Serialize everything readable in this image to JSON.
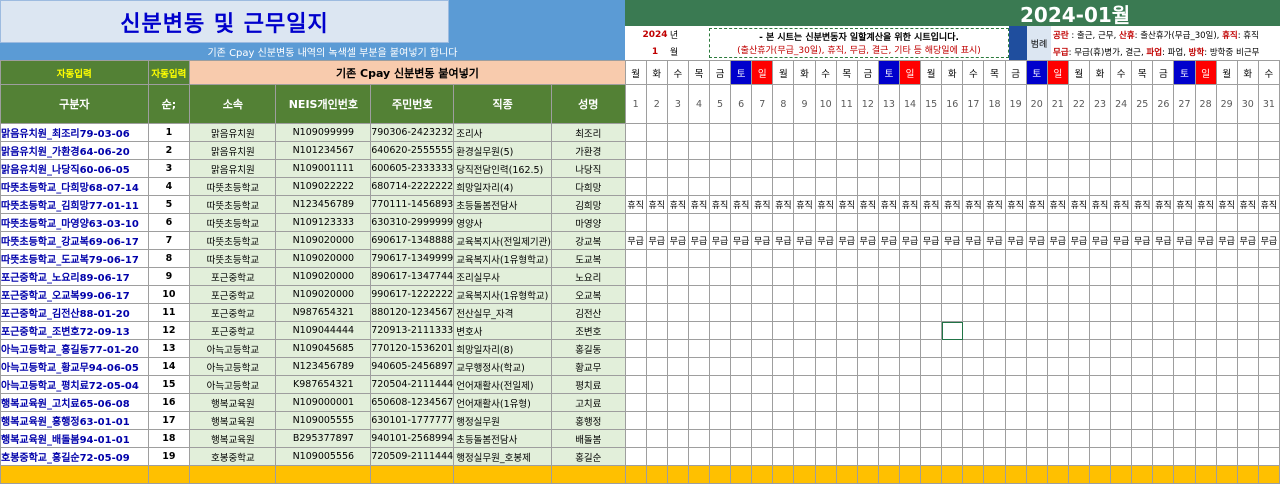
{
  "header": {
    "title": "신분변동 및 근무일지",
    "notice": "기존 Cpay 신분변동 내역의 녹색셀 부분을 붙여넣기 합니다",
    "month_title": "2024-01월",
    "year": "2024",
    "year_unit": "년",
    "month": "1",
    "month_unit": "월",
    "note_line1": "- 본 시트는 신분변동자 일할계산을 위한 시트입니다.",
    "note_line2": "(출산휴가(무급_30일), 휴직, 무급, 결근, 기타 등 해당일에 표시)",
    "legend_label": "범례",
    "legend_line1_red": "공란",
    "legend_line1_text": " : 출근, 근무, ",
    "legend_line1_red2": "산휴",
    "legend_line1_text2": ": 출산휴가(무급_30일),   ",
    "legend_line1_red3": "휴직",
    "legend_line1_text3": ": 휴직",
    "legend_line2_red": "무급",
    "legend_line2_text": ": 무급(휴)병가, 결근, ",
    "legend_line2_red2": "파업",
    "legend_line2_text2": ": 파업, ",
    "legend_line2_red3": "방학",
    "legend_line2_text3": ": 방학중 비근무"
  },
  "table_header": {
    "auto_input_1": "자동입력",
    "auto_input_2": "자동입력",
    "paste_title": "기존 Cpay 신분변동 붙여넣기",
    "columns": [
      "구분자",
      "순;",
      "소속",
      "NEIS개인번호",
      "주민번호",
      "직종",
      "성명"
    ]
  },
  "days": [
    {
      "dow": "월",
      "num": "1"
    },
    {
      "dow": "화",
      "num": "2"
    },
    {
      "dow": "수",
      "num": "3"
    },
    {
      "dow": "목",
      "num": "4"
    },
    {
      "dow": "금",
      "num": "5"
    },
    {
      "dow": "토",
      "num": "6"
    },
    {
      "dow": "일",
      "num": "7"
    },
    {
      "dow": "월",
      "num": "8"
    },
    {
      "dow": "화",
      "num": "9"
    },
    {
      "dow": "수",
      "num": "10"
    },
    {
      "dow": "목",
      "num": "11"
    },
    {
      "dow": "금",
      "num": "12"
    },
    {
      "dow": "토",
      "num": "13"
    },
    {
      "dow": "일",
      "num": "14"
    },
    {
      "dow": "월",
      "num": "15"
    },
    {
      "dow": "화",
      "num": "16"
    },
    {
      "dow": "수",
      "num": "17"
    },
    {
      "dow": "목",
      "num": "18"
    },
    {
      "dow": "금",
      "num": "19"
    },
    {
      "dow": "토",
      "num": "20"
    },
    {
      "dow": "일",
      "num": "21"
    },
    {
      "dow": "월",
      "num": "22"
    },
    {
      "dow": "화",
      "num": "23"
    },
    {
      "dow": "수",
      "num": "24"
    },
    {
      "dow": "목",
      "num": "25"
    },
    {
      "dow": "금",
      "num": "26"
    },
    {
      "dow": "토",
      "num": "27"
    },
    {
      "dow": "일",
      "num": "28"
    },
    {
      "dow": "월",
      "num": "29"
    },
    {
      "dow": "화",
      "num": "30"
    },
    {
      "dow": "수",
      "num": "31"
    }
  ],
  "rows": [
    {
      "key": "맑음유치원_최조리79-03-06",
      "no": "1",
      "org": "맑음유치원",
      "neis": "N109099999",
      "rrn": "790306-2423232",
      "job": "조리사",
      "name": "최조리",
      "status": ""
    },
    {
      "key": "맑음유치원_가환경64-06-20",
      "no": "2",
      "org": "맑음유치원",
      "neis": "N101234567",
      "rrn": "640620-2555555",
      "job": "환경실무원(5)",
      "name": "가환경",
      "status": ""
    },
    {
      "key": "맑음유치원_나당직60-06-05",
      "no": "3",
      "org": "맑음유치원",
      "neis": "N109001111",
      "rrn": "600605-2333333",
      "job": "당직전담인력(162.5)",
      "name": "나당직",
      "status": ""
    },
    {
      "key": "따뜻초등학교_다희망68-07-14",
      "no": "4",
      "org": "따뜻초등학교",
      "neis": "N109022222",
      "rrn": "680714-2222222",
      "job": "희망일자리(4)",
      "name": "다희망",
      "status": ""
    },
    {
      "key": "따뜻초등학교_김희망77-01-11",
      "no": "5",
      "org": "따뜻초등학교",
      "neis": "N123456789",
      "rrn": "770111-1456893",
      "job": "초등돌봄전담사",
      "name": "김희망",
      "status": "휴직"
    },
    {
      "key": "따뜻초등학교_마영양63-03-10",
      "no": "6",
      "org": "따뜻초등학교",
      "neis": "N109123333",
      "rrn": "630310-2999999",
      "job": "영양사",
      "name": "마영양",
      "status": ""
    },
    {
      "key": "따뜻초등학교_강교복69-06-17",
      "no": "7",
      "org": "따뜻초등학교",
      "neis": "N109020000",
      "rrn": "690617-1348888",
      "job": "교육복지사(전일제기관)",
      "name": "강교복",
      "status": "무급"
    },
    {
      "key": "따뜻초등학교_도교복79-06-17",
      "no": "8",
      "org": "따뜻초등학교",
      "neis": "N109020000",
      "rrn": "790617-1349999",
      "job": "교육복지사(1유형학교)",
      "name": "도교복",
      "status": ""
    },
    {
      "key": "포근중학교_노요리89-06-17",
      "no": "9",
      "org": "포근중학교",
      "neis": "N109020000",
      "rrn": "890617-1347744",
      "job": "조리실무사",
      "name": "노요리",
      "status": ""
    },
    {
      "key": "포근중학교_오교복99-06-17",
      "no": "10",
      "org": "포근중학교",
      "neis": "N109020000",
      "rrn": "990617-1222222",
      "job": "교육복지사(1유형학교)",
      "name": "오교복",
      "status": ""
    },
    {
      "key": "포근중학교_김전산88-01-20",
      "no": "11",
      "org": "포근중학교",
      "neis": "N987654321",
      "rrn": "880120-1234567",
      "job": "전산실무_자격",
      "name": "김전산",
      "status": ""
    },
    {
      "key": "포근중학교_조변호72-09-13",
      "no": "12",
      "org": "포근중학교",
      "neis": "N109044444",
      "rrn": "720913-2111333",
      "job": "변호사",
      "name": "조변호",
      "status": ""
    },
    {
      "key": "아늑고등학교_홍길동77-01-20",
      "no": "13",
      "org": "아늑고등학교",
      "neis": "N109045685",
      "rrn": "770120-1536201",
      "job": "희망일자리(8)",
      "name": "홍길동",
      "status": ""
    },
    {
      "key": "아늑고등학교_황교무94-06-05",
      "no": "14",
      "org": "아늑고등학교",
      "neis": "N123456789",
      "rrn": "940605-2456897",
      "job": "교무행정사(학교)",
      "name": "황교무",
      "status": ""
    },
    {
      "key": "아늑고등학교_평치료72-05-04",
      "no": "15",
      "org": "아늑고등학교",
      "neis": "K987654321",
      "rrn": "720504-2111444",
      "job": "언어재활사(전일제)",
      "name": "평치료",
      "status": ""
    },
    {
      "key": "행복교육원_고치료65-06-08",
      "no": "16",
      "org": "행복교육원",
      "neis": "N109000001",
      "rrn": "650608-1234567",
      "job": "언어재활사(1유형)",
      "name": "고치료",
      "status": ""
    },
    {
      "key": "행복교육원_홍행정63-01-01",
      "no": "17",
      "org": "행복교육원",
      "neis": "N109005555",
      "rrn": "630101-1777777",
      "job": "행정실무원",
      "name": "홍행정",
      "status": ""
    },
    {
      "key": "행복교육원_배돌봄94-01-01",
      "no": "18",
      "org": "행복교육원",
      "neis": "B295377897",
      "rrn": "940101-2568994",
      "job": "초등돌봄전담사",
      "name": "배돌봄",
      "status": ""
    },
    {
      "key": "호봉중학교_홍길순72-05-09",
      "no": "19",
      "org": "호봉중학교",
      "neis": "N109005556",
      "rrn": "720509-2111444",
      "job": "행정실무원_호봉제",
      "name": "홍길순",
      "status": ""
    }
  ]
}
